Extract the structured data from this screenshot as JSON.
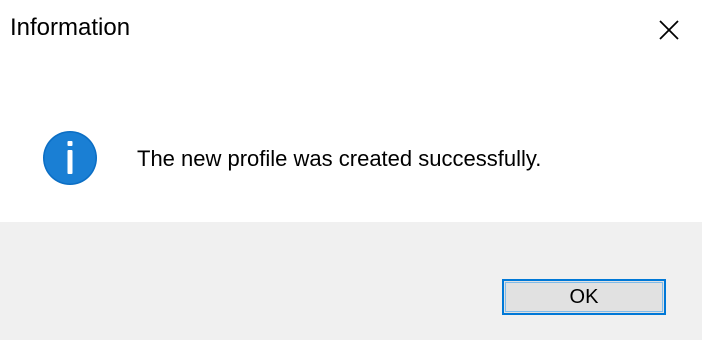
{
  "dialog": {
    "title": "Information",
    "message": "The new profile was created successfully.",
    "icon": "info-icon",
    "close_icon": "close-icon",
    "ok_label": "OK",
    "colors": {
      "icon_blue": "#0b6ec4",
      "button_border": "#0078d7",
      "button_face": "#e1e1e1",
      "footer_bg": "#f0f0f0"
    }
  }
}
